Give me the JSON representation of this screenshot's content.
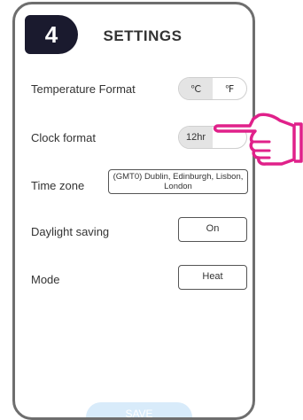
{
  "step_number": "4",
  "title": "SETTINGS",
  "temperature": {
    "label": "Temperature Format",
    "options": [
      "℃",
      "℉"
    ],
    "selected": "℃"
  },
  "clock": {
    "label": "Clock format",
    "options": [
      "12hr",
      ""
    ],
    "selected": "12hr"
  },
  "timezone": {
    "label": "Time zone",
    "value": "(GMT0) Dublin, Edinburgh, Lisbon, London"
  },
  "daylight": {
    "label": "Daylight saving",
    "value": "On"
  },
  "mode": {
    "label": "Mode",
    "value": "Heat"
  },
  "save_label": "SAVE",
  "colors": {
    "badge": "#1a1a2e",
    "hand_outline": "#e0218a",
    "save_button": "#d8ebfa"
  },
  "pointer_icon": "pointing-hand-icon"
}
